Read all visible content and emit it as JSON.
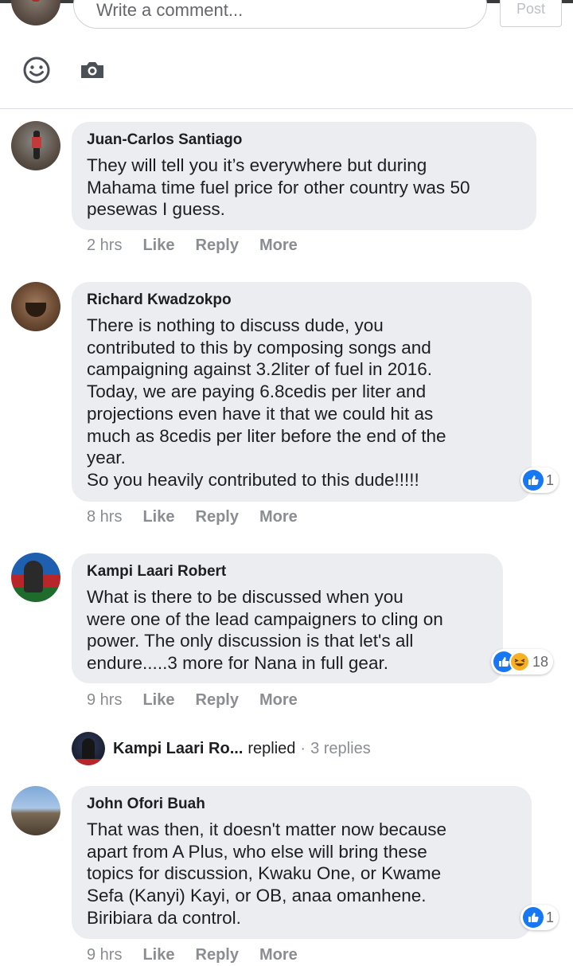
{
  "composer": {
    "placeholder": "Write a comment...",
    "post_label": "Post",
    "emoji_icon": "smiley-icon",
    "camera_icon": "camera-icon"
  },
  "comments": [
    {
      "author": "Juan-Carlos Santiago",
      "text": "They will tell you it’s everywhere but during\nMahama time fuel price for other country was 50\npesewas I guess.",
      "time": "2 hrs",
      "like": "Like",
      "reply": "Reply",
      "more": "More"
    },
    {
      "author": "Richard Kwadzokpo",
      "text": "There is nothing to discuss dude, you\ncontributed to this by composing songs and\ncampaigning against 3.2liter of fuel in 2016.\nToday, we are paying 6.8cedis per liter and\nprojections even have it that we could hit as\nmuch as 8cedis per liter before the end of the\nyear.\nSo you heavily contributed to this dude!!!!!",
      "time": "8 hrs",
      "like": "Like",
      "reply": "Reply",
      "more": "More",
      "reaction_count": "1"
    },
    {
      "author": "Kampi Laari Robert",
      "text": "What is there to be discussed when you\nwere one of the lead campaigners to cling on\npower. The only discussion is that let's all\nendure.....3 more for Nana in full gear.",
      "time": "9 hrs",
      "like": "Like",
      "reply": "Reply",
      "more": "More",
      "reaction_count": "18"
    },
    {
      "author": "John Ofori Buah",
      "text": "That was then, it doesn't matter now because\napart from A Plus, who else will bring these\ntopics for discussion, Kwaku One, or Kwame\nSefa (Kanyi) Kayi, or OB, anaa omanhene.\nBiribiara da control.",
      "time": "9 hrs",
      "like": "Like",
      "reply": "Reply",
      "more": "More",
      "reaction_count": "1"
    }
  ],
  "reply_thread": {
    "name": "Kampi Laari Ro...",
    "verb": "replied",
    "sep": "·",
    "count": "3 replies"
  },
  "colors": {
    "like_blue": "#1877f2",
    "bubble": "#ebedf0",
    "meta_gray": "#8a8d91"
  }
}
